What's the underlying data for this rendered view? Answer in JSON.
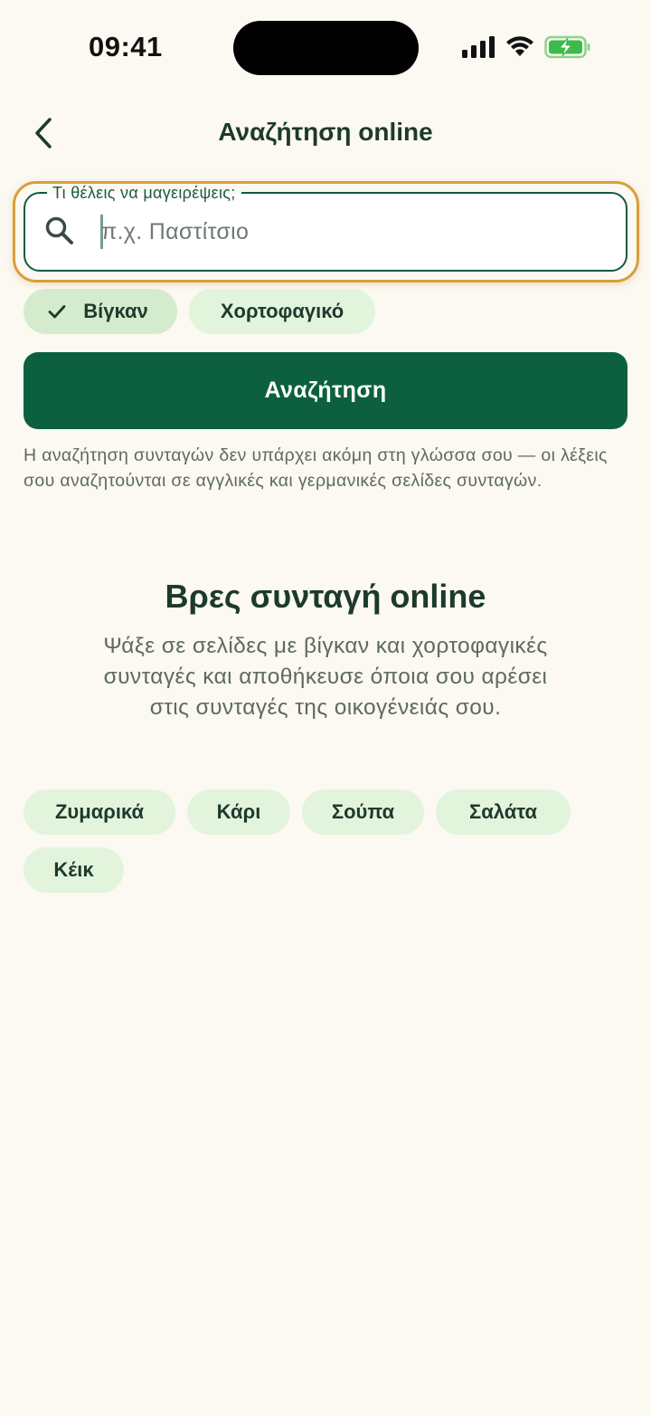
{
  "status_bar": {
    "time": "09:41"
  },
  "header": {
    "title": "Αναζήτηση online",
    "back_icon": "chevron-left-icon"
  },
  "search": {
    "label": "Τι θέλεις να μαγειρέψεις;",
    "placeholder": "π.χ. Παστίτσιο",
    "value": "",
    "icon": "search-icon"
  },
  "filters": [
    {
      "label": "Βίγκαν",
      "selected": true
    },
    {
      "label": "Χορτοφαγικό",
      "selected": false
    }
  ],
  "search_button": {
    "label": "Αναζήτηση"
  },
  "notice": "Η αναζήτηση συνταγών δεν υπάρχει ακόμη στη γλώσσα σου — οι λέξεις σου αναζητούνται σε αγγλικές και γερμανικές σελίδες συνταγών.",
  "empty_state": {
    "title": "Βρες συνταγή online",
    "description": "Ψάξε σε σελίδες με βίγκαν και χορτοφαγικές συνταγές και αποθήκευσε όποια σου αρέσει στις συνταγές της οικογένειάς σου."
  },
  "suggestions": [
    "Ζυμαρικά",
    "Κάρι",
    "Σούπα",
    "Σαλάτα",
    "Κέικ"
  ],
  "colors": {
    "background": "#fbf9f1",
    "primary": "#0c6040",
    "chip_selected": "#d4eccd",
    "chip": "#e3f4dd",
    "focus_ring": "#d99e3c",
    "text": "#1d3a2c"
  }
}
